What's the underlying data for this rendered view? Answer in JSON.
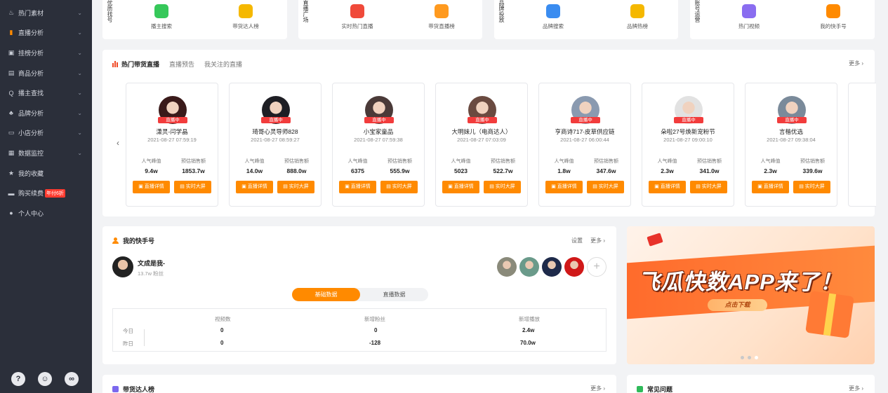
{
  "sidebar": {
    "items": [
      {
        "label": "热门素材",
        "icon": "fire-icon",
        "glyph": "♨"
      },
      {
        "label": "直播分析",
        "icon": "bar-chart-icon",
        "glyph": "▮"
      },
      {
        "label": "挂榜分析",
        "icon": "line-chart-icon",
        "glyph": "▣"
      },
      {
        "label": "商品分析",
        "icon": "bag-icon",
        "glyph": "▤"
      },
      {
        "label": "播主查找",
        "icon": "search-icon",
        "glyph": "Q"
      },
      {
        "label": "品牌分析",
        "icon": "brand-icon",
        "glyph": "♣"
      },
      {
        "label": "小店分析",
        "icon": "shop-icon",
        "glyph": "▭"
      },
      {
        "label": "数据监控",
        "icon": "monitor-icon",
        "glyph": "▦"
      },
      {
        "label": "我的收藏",
        "icon": "star-icon",
        "glyph": "★"
      },
      {
        "label": "购买续费",
        "icon": "card-icon",
        "glyph": "▬",
        "badge": "年付6折"
      },
      {
        "label": "个人中心",
        "icon": "user-icon",
        "glyph": "●"
      }
    ],
    "bottom": [
      "?",
      "☺",
      "∞"
    ]
  },
  "categories": [
    {
      "side": "优质找号",
      "entries": [
        {
          "label": "播主搜索",
          "color": "#36c85a"
        },
        {
          "label": "带货达人榜",
          "color": "#f5b800"
        }
      ]
    },
    {
      "side": "直播广场",
      "entries": [
        {
          "label": "实时热门直播",
          "color": "#f04a3a"
        },
        {
          "label": "带货直播榜",
          "color": "#ff9a1f"
        }
      ]
    },
    {
      "side": "品牌投放",
      "entries": [
        {
          "label": "品牌搜索",
          "color": "#3a8cf0"
        },
        {
          "label": "品牌热榜",
          "color": "#f5b800"
        }
      ]
    },
    {
      "side": "账号运营",
      "entries": [
        {
          "label": "热门视频",
          "color": "#8a6df0"
        },
        {
          "label": "我的快手号",
          "color": "#ff8a00"
        }
      ]
    }
  ],
  "live_panel": {
    "tabs": [
      "热门带货直播",
      "直播预告",
      "我关注的直播"
    ],
    "more": "更多",
    "live_tag": "直播中",
    "label_popularity": "人气峰值",
    "label_sales": "预估销售额",
    "btn_detail": "直播详情",
    "btn_screen": "实时大屏",
    "prev": "‹",
    "next": "›",
    "anchors": [
      {
        "name": "潇灵-闫学晶",
        "time": "2021-08-27 07:59:19",
        "popularity": "9.4w",
        "sales": "1853.7w",
        "avatar_color": "#3a1a1a"
      },
      {
        "name": "琦哥心灵导师828",
        "time": "2021-08-27 08:59:27",
        "popularity": "14.0w",
        "sales": "888.0w",
        "avatar_color": "#1e1e24"
      },
      {
        "name": "小宝家童品",
        "time": "2021-08-27 07:59:38",
        "popularity": "6375",
        "sales": "555.9w",
        "avatar_color": "#4a3a38"
      },
      {
        "name": "大明妹儿（电商达人）",
        "time": "2021-08-27 07:03:09",
        "popularity": "5023",
        "sales": "522.7w",
        "avatar_color": "#6a4a40"
      },
      {
        "name": "亨商诗717-皮草供应链",
        "time": "2021-08-27 06:00:44",
        "popularity": "1.8w",
        "sales": "347.6w",
        "avatar_color": "#8a9ab0"
      },
      {
        "name": "朵啦27号焕新宠粉节",
        "time": "2021-08-27 09:00:10",
        "popularity": "2.3w",
        "sales": "341.0w",
        "avatar_color": "#e2e2e2"
      },
      {
        "name": "言楷优选",
        "time": "2021-08-27 09:38:04",
        "popularity": "2.3w",
        "sales": "339.6w",
        "avatar_color": "#7a8a9a"
      }
    ]
  },
  "my_panel": {
    "title": "我的快手号",
    "settings": "设置",
    "more": "更多",
    "name": "文成是我-",
    "fans": "13.7w 粉丝",
    "fav_colors": [
      "#8a8a7a",
      "#6a9a8a",
      "#1e2a4a",
      "#d01818"
    ],
    "add": "+",
    "tab_basic": "基础数据",
    "tab_live": "直播数据",
    "headers": [
      "视频数",
      "新增粉丝",
      "新增播放"
    ],
    "rows": [
      {
        "label": "今日",
        "values": [
          "0",
          "0",
          "2.4w"
        ]
      },
      {
        "label": "昨日",
        "values": [
          "0",
          "-128",
          "70.0w"
        ]
      }
    ]
  },
  "banner": {
    "title": "飞瓜快数APP来了！",
    "download": "点击下载"
  },
  "bottom": {
    "left_title": "带货达人榜",
    "right_title": "常见问题",
    "more": "更多"
  }
}
